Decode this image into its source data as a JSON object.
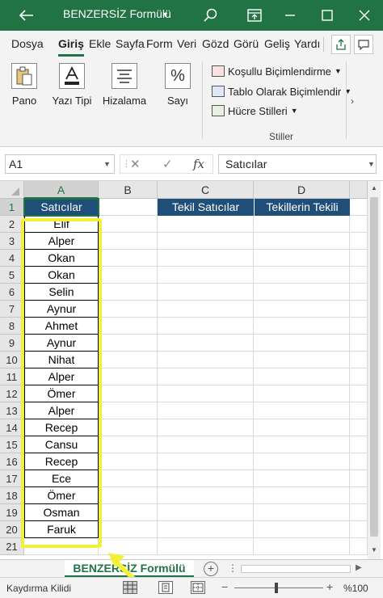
{
  "titlebar": {
    "title": "BENZERSİZ Formülü"
  },
  "ribbon_tabs": [
    "Dosya",
    "Giriş",
    "Ekle",
    "Sayfa",
    "Form",
    "Veri",
    "Gözd",
    "Görü",
    "Geliş",
    "Yardı"
  ],
  "ribbon": {
    "groups": [
      {
        "label": "Pano",
        "icon": "clipboard-icon"
      },
      {
        "label": "Yazı Tipi",
        "icon": "font-icon"
      },
      {
        "label": "Hizalama",
        "icon": "align-icon"
      },
      {
        "label": "Sayı",
        "icon": "percent-icon"
      }
    ],
    "styles": {
      "items": [
        "Koşullu Biçimlendirme",
        "Tablo Olarak Biçimlendir",
        "Hücre Stilleri"
      ],
      "group_label": "Stiller"
    }
  },
  "formula_bar": {
    "name_box": "A1",
    "formula": "Satıcılar"
  },
  "grid": {
    "columns": [
      "A",
      "B",
      "C",
      "D"
    ],
    "rows": [
      "1",
      "2",
      "3",
      "4",
      "5",
      "6",
      "7",
      "8",
      "9",
      "10",
      "11",
      "12",
      "13",
      "14",
      "15",
      "16",
      "17",
      "18",
      "19",
      "20",
      "21"
    ],
    "a1_header": "Satıcılar",
    "c1_header": "Tekil Satıcılar",
    "d1_header": "Tekillerin Tekili",
    "sellers": [
      "Elif",
      "Alper",
      "Okan",
      "Okan",
      "Selin",
      "Aynur",
      "Ahmet",
      "Aynur",
      "Nihat",
      "Alper",
      "Ömer",
      "Alper",
      "Recep",
      "Cansu",
      "Recep",
      "Ece",
      "Ömer",
      "Osman",
      "Faruk"
    ]
  },
  "sheet_tab": "BENZERSİZ Formülü",
  "status": {
    "mode": "Kaydırma Kilidi",
    "zoom": "%100"
  },
  "colors": {
    "accent": "#217346",
    "header_fill": "#1f4e79",
    "highlight": "#f4f03a"
  }
}
